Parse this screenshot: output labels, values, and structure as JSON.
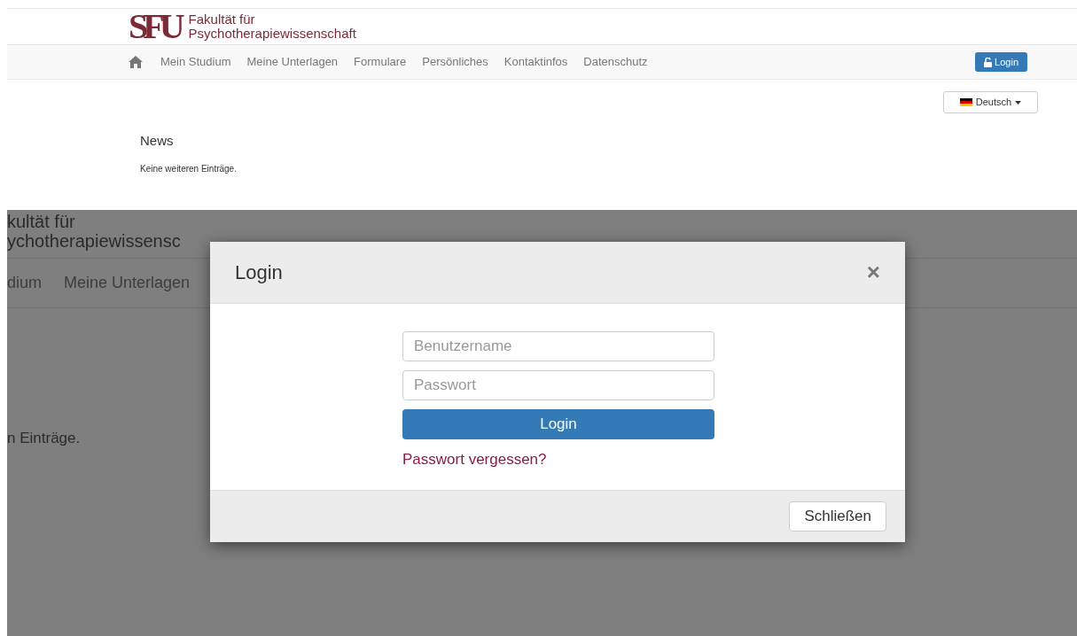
{
  "page": {
    "logo": "SFU",
    "faculty_line_1": "Fakultät für",
    "faculty_line_2": "Psychotherapiewissenschaft",
    "nav": [
      {
        "label": "Mein Studium"
      },
      {
        "label": "Meine Unterlagen"
      },
      {
        "label": "Formulare"
      },
      {
        "label": "Persönliches"
      },
      {
        "label": "Kontaktinfos"
      },
      {
        "label": "Datenschutz"
      }
    ],
    "login_button": "Login",
    "language": "Deutsch",
    "news_title": "News",
    "news_text": "Keine weiteren Einträge."
  },
  "zoomed_background": {
    "faculty_line_1": "kultät für",
    "faculty_line_2": "ychotherapiewissensc",
    "nav": [
      {
        "label": "dium"
      },
      {
        "label": "Meine Unterlagen"
      }
    ],
    "news_text": "n Einträge."
  },
  "dialog": {
    "title": "Login",
    "close": "×",
    "username": {
      "placeholder": "Benutzername"
    },
    "password": {
      "placeholder": "Passwort"
    },
    "submit": "Login",
    "forgot_link": "Passwort vergessen?",
    "close_button": "Schließen"
  }
}
